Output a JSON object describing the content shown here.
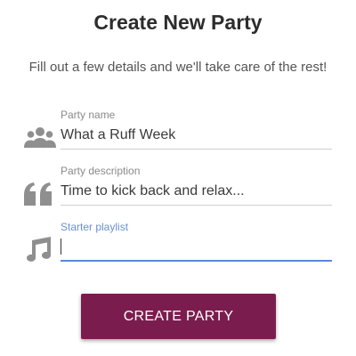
{
  "header": {
    "title": "Create New Party",
    "subtitle": "Fill out a few details and we'll take care of the rest!"
  },
  "form": {
    "party_name": {
      "label": "Party name",
      "value": "What a Ruff Week",
      "icon": "group-icon"
    },
    "party_description": {
      "label": "Party description",
      "value": "Time to kick back and relax...",
      "icon": "quote-icon"
    },
    "starter_playlist": {
      "label": "Starter playlist",
      "value": "",
      "icon": "music-note-icon"
    }
  },
  "actions": {
    "create_label": "CREATE PARTY"
  },
  "colors": {
    "accent": "#5b86d6",
    "button": "#7a1d4e",
    "icon": "#8f8f8f"
  }
}
